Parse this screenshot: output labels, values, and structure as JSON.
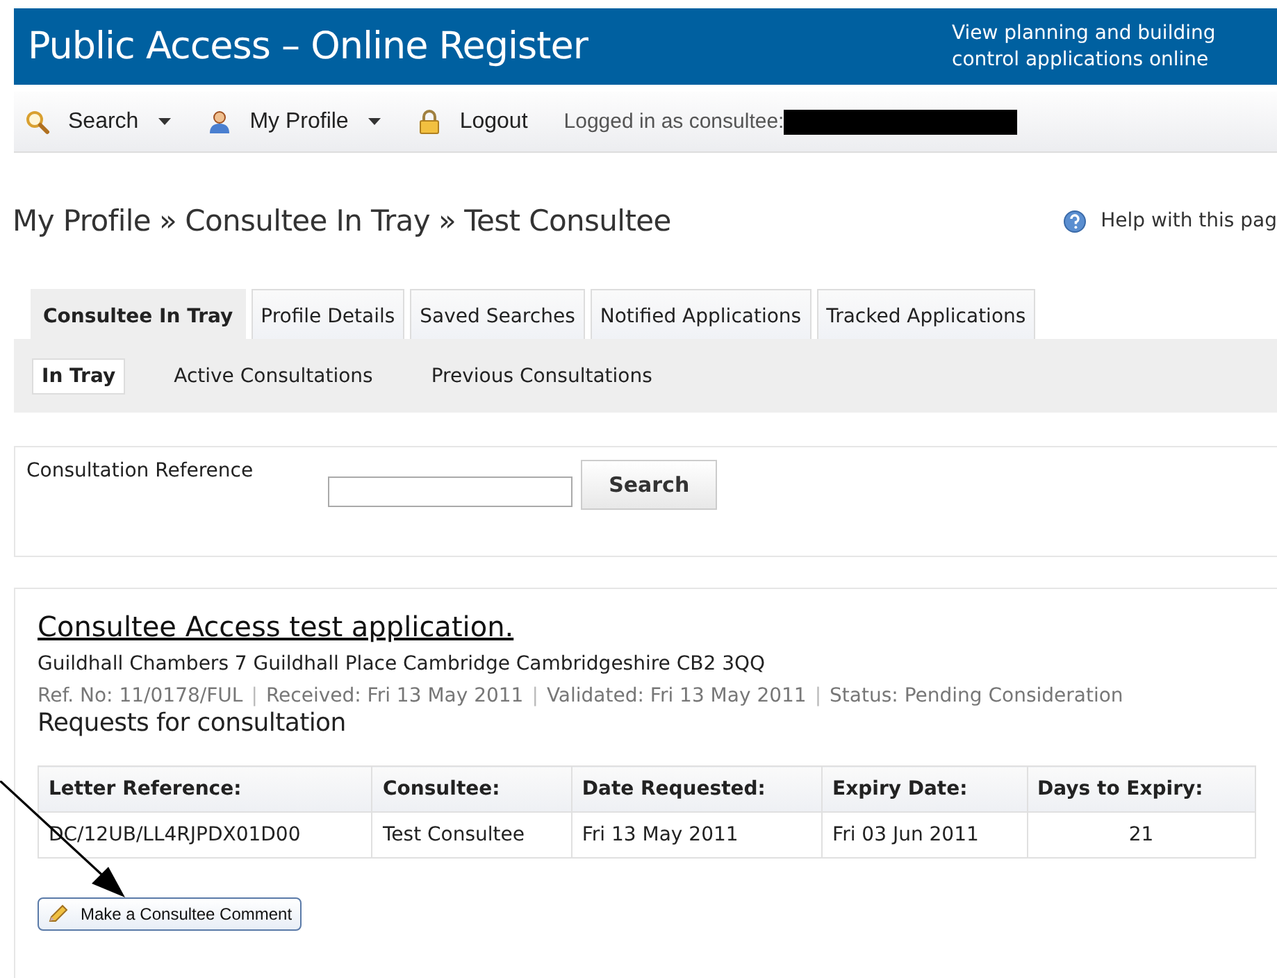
{
  "header": {
    "title": "Public Access – Online Register",
    "tagline": "View planning and building control applications online"
  },
  "nav": {
    "items": [
      {
        "kind": "search",
        "label": "Search",
        "dropdown": true
      },
      {
        "kind": "profile",
        "label": "My Profile",
        "dropdown": true
      },
      {
        "kind": "lock",
        "label": "Logout",
        "dropdown": false
      }
    ],
    "logged_in": "Logged in as consultee:"
  },
  "breadcrumb": [
    "My Profile",
    "Consultee In Tray",
    "Test Consultee"
  ],
  "breadcrumb_separator": "»",
  "help": "Help with this pag",
  "tabs": [
    {
      "label": "Consultee In Tray",
      "selected": true
    },
    {
      "label": "Profile Details",
      "selected": false
    },
    {
      "label": "Saved Searches",
      "selected": false
    },
    {
      "label": "Notified Applications",
      "selected": false
    },
    {
      "label": "Tracked Applications",
      "selected": false
    }
  ],
  "subtabs": [
    {
      "label": "In Tray",
      "selected": true
    },
    {
      "label": "Active Consultations",
      "selected": false
    },
    {
      "label": "Previous Consultations",
      "selected": false
    }
  ],
  "search_form": {
    "label": "Consultation Reference",
    "button": "Search"
  },
  "application": {
    "title": "Consultee Access test application.",
    "address": "Guildhall Chambers 7 Guildhall Place Cambridge Cambridgeshire CB2 3QQ",
    "meta": [
      "Ref. No: 11/0178/FUL",
      "Received: Fri 13 May 2011",
      "Validated: Fri 13 May 2011",
      "Status: Pending Consideration"
    ],
    "meta_separator": "|"
  },
  "requests": {
    "heading": "Requests for consultation",
    "columns": [
      "Letter Reference:",
      "Consultee:",
      "Date Requested:",
      "Expiry Date:",
      "Days to Expiry:"
    ],
    "rows": [
      [
        "DC/12UB/LL4RJPDX01D00",
        "Test Consultee",
        "Fri 13 May 2011",
        "Fri 03 Jun 2011",
        "21"
      ]
    ]
  },
  "comment_button": "Make a Consultee Comment"
}
